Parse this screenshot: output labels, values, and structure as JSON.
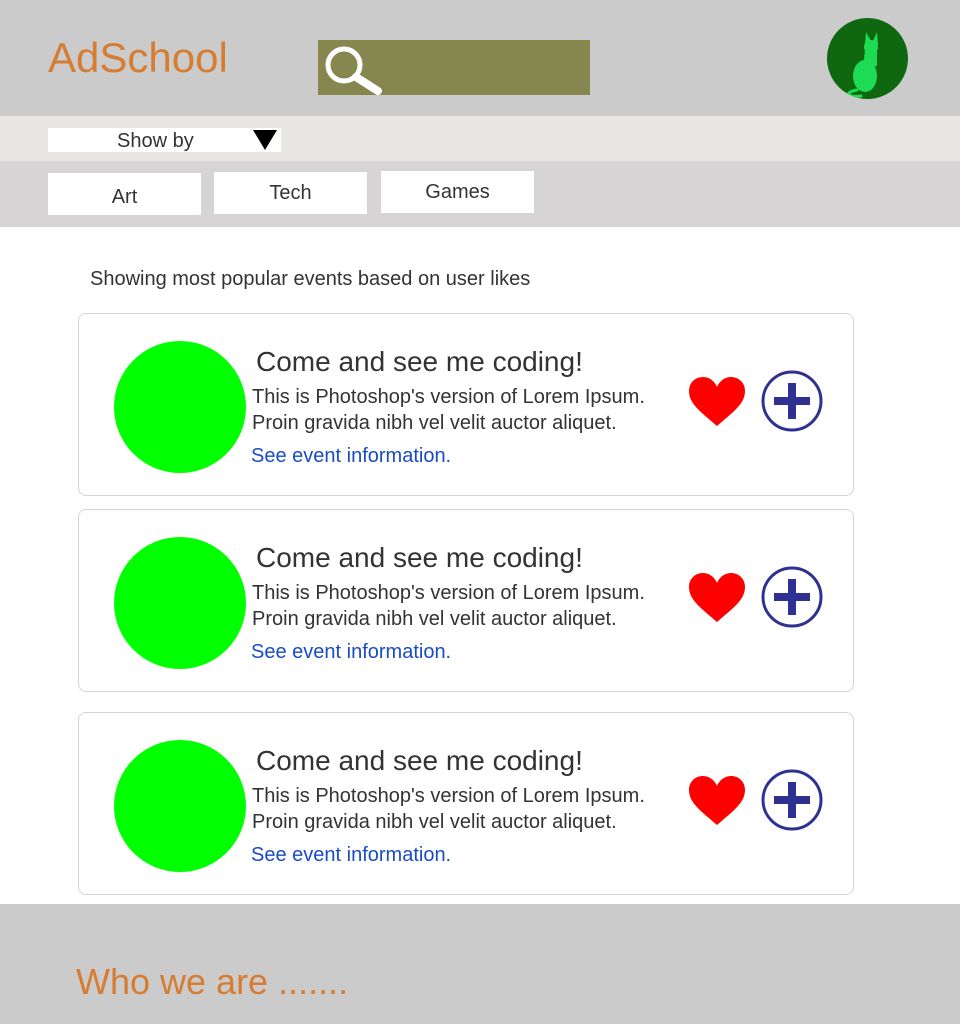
{
  "header": {
    "logo": "AdSchool",
    "search_icon": "search-icon",
    "avatar_icon": "cat-icon"
  },
  "filter": {
    "show_by_label": "Show by",
    "arrow_icon": "dropdown-arrow-icon"
  },
  "categories": [
    "Art",
    "Tech",
    "Games"
  ],
  "intro": "Showing most popular events based on user likes",
  "events": [
    {
      "title": "Come and see me coding!",
      "desc_line1": "This is Photoshop's version  of Lorem Ipsum.",
      "desc_line2": "Proin gravida nibh vel velit auctor aliquet.",
      "link": "See event information.",
      "like_icon": "heart-icon",
      "add_icon": "plus-circle-icon"
    },
    {
      "title": "Come and see me coding!",
      "desc_line1": "This is Photoshop's version  of Lorem Ipsum.",
      "desc_line2": "Proin gravida nibh vel velit auctor aliquet.",
      "link": "See event information.",
      "like_icon": "heart-icon",
      "add_icon": "plus-circle-icon"
    },
    {
      "title": "Come and see me coding!",
      "desc_line1": "This is Photoshop's version  of Lorem Ipsum.",
      "desc_line2": "Proin gravida nibh vel velit auctor aliquet.",
      "link": "See event information.",
      "like_icon": "heart-icon",
      "add_icon": "plus-circle-icon"
    }
  ],
  "footer": {
    "text": "Who we are ......."
  },
  "colors": {
    "brand": "#d67d33",
    "header_bg": "#cbcbcb",
    "search_bg": "#85874f",
    "avatar_bg": "#0f670f",
    "cat_icon": "#1ddc53",
    "thumb": "#00ff00",
    "heart": "#ff0000",
    "add": "#2e3192",
    "link": "#1a4bc7"
  }
}
